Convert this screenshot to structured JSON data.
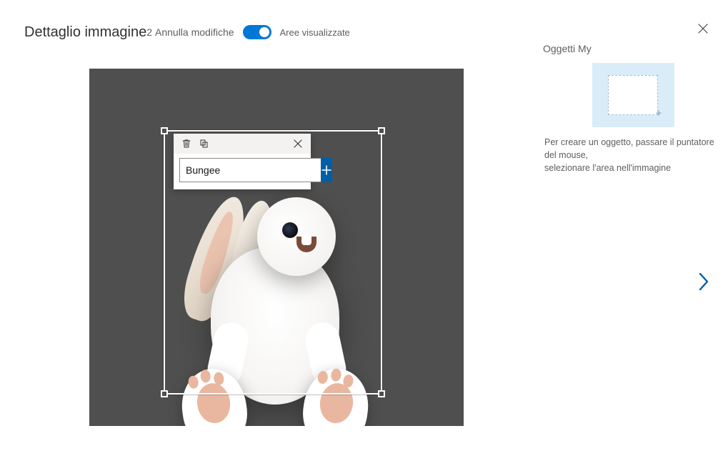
{
  "header": {
    "title": "Dettaglio immagine",
    "count": "2",
    "undo_label": "Annulla modifiche",
    "toggle_label": "Aree visualizzate",
    "toggle_on": true
  },
  "tool": {
    "tag_value": "Bungee"
  },
  "sidebar": {
    "title": "Oggetti My",
    "hint_line1": "Per creare un oggetto, passare il puntatore del mouse,",
    "hint_line2": "selezionare l'area nell'immagine"
  }
}
